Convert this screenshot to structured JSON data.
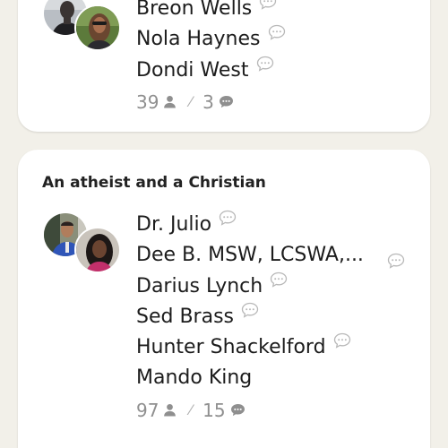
{
  "rooms": [
    {
      "title": "",
      "speakers": [
        {
          "name": "Breon Wells"
        },
        {
          "name": "Nola Haynes"
        },
        {
          "name": "Dondi West"
        }
      ],
      "listener_count": "39",
      "speaker_count": "3"
    },
    {
      "title": "An atheist and a Christian",
      "speakers": [
        {
          "name": "Dr. Julio"
        },
        {
          "name": "Dee B. MSW, LCSWA,..."
        },
        {
          "name": "Darius Lynch"
        },
        {
          "name": "Sed Brass"
        },
        {
          "name": "Hunter Shackelford"
        },
        {
          "name": "Mando King"
        }
      ],
      "listener_count": "97",
      "speaker_count": "15"
    }
  ],
  "icons": {
    "speech_bubble": "speech-bubble-icon",
    "person": "person-icon",
    "chat": "chat-icon"
  },
  "colors": {
    "background": "#f2f0e9",
    "card": "#ffffff",
    "text": "#1c1c1c",
    "muted": "#8f8f8f"
  }
}
